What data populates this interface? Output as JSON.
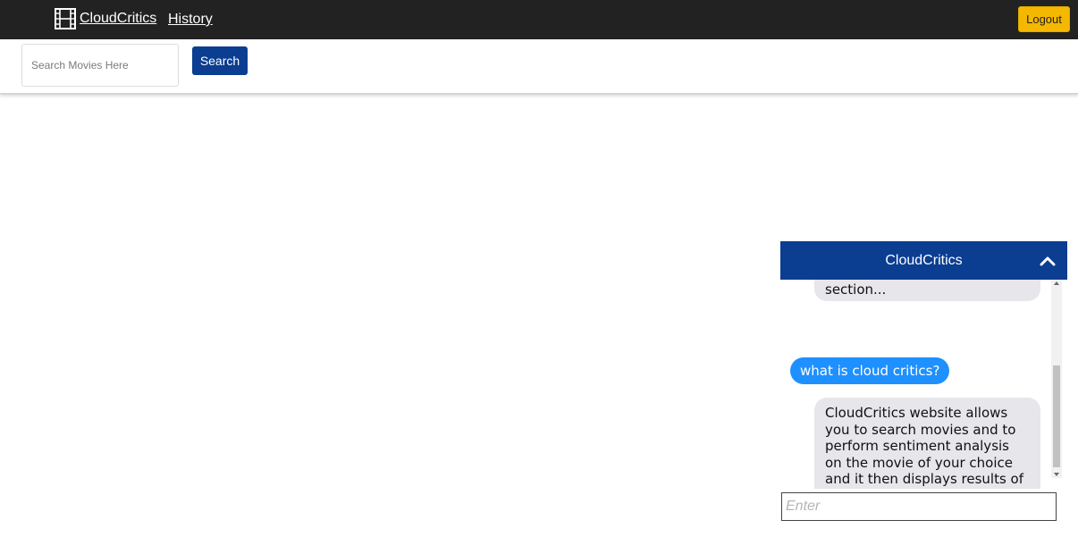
{
  "navbar": {
    "brand": "CloudCritics",
    "brand_icon": "film-icon",
    "history": "History",
    "logout": "Logout",
    "colors": {
      "background": "#222222",
      "logout": "#f5b800"
    }
  },
  "search": {
    "placeholder": "Search Movies Here",
    "value": "",
    "button": "Search",
    "button_color": "#0b3d91"
  },
  "chat": {
    "title": "CloudCritics",
    "toggle_icon": "chevron-up-icon",
    "header_color": "#0b3d91",
    "messages": [
      {
        "from": "bot",
        "text": "section..."
      },
      {
        "from": "user",
        "text": "what is cloud critics?"
      },
      {
        "from": "bot",
        "text": "CloudCritics website allows you to search movies and to perform sentiment analysis on the movie of your choice and it then displays results of sentiment analysis on the movie review."
      }
    ],
    "input_placeholder": "Enter",
    "user_bubble_color": "#1e90ff",
    "bot_bubble_color": "#e6e6eb"
  }
}
